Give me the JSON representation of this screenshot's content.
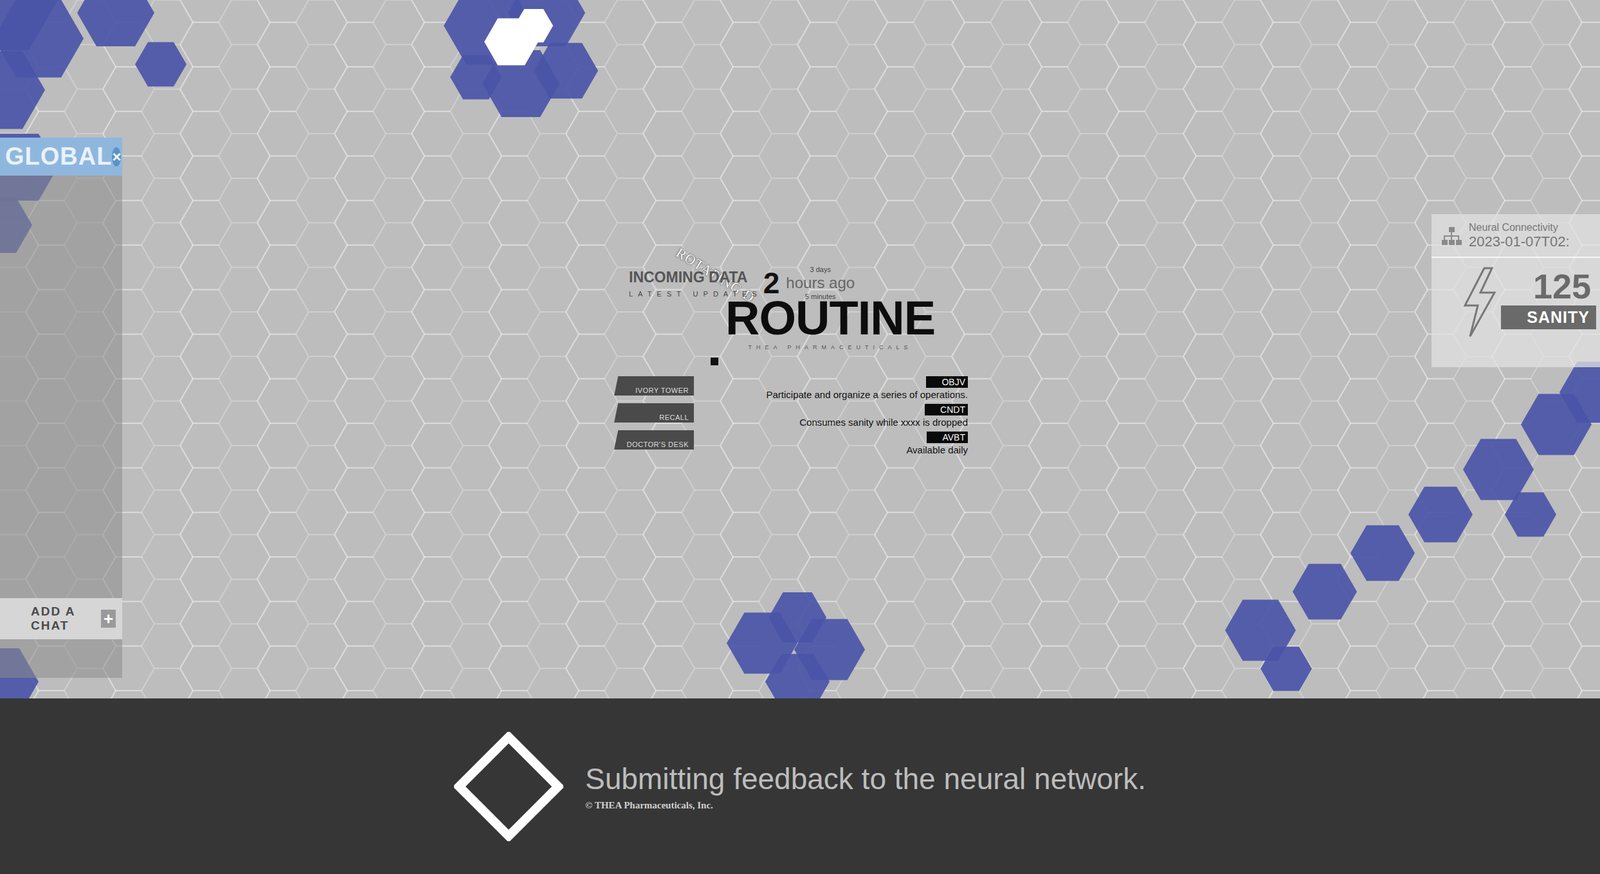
{
  "chat_panel": {
    "tab": "GLOBAL",
    "close": "×",
    "add_label": "ADD A CHAT",
    "add_icon": "+"
  },
  "rotating_label": "ROTATING D",
  "incoming": {
    "title": "INCOMING DATA",
    "subtitle": "LATEST UPDATES",
    "count": "2",
    "options": [
      {
        "label": "3 days",
        "selected": false
      },
      {
        "label": "hours ago",
        "selected": true
      },
      {
        "label": "5 minutes",
        "selected": false
      }
    ]
  },
  "routine": {
    "title": "ROUTINE",
    "brand": "THEA PHARMACEUTICALS",
    "menu": [
      "IVORY TOWER",
      "RECALL",
      "DOCTOR'S DESK"
    ],
    "details": [
      {
        "tag": "OBJV",
        "text": "Participate and organize a series of operations."
      },
      {
        "tag": "CNDT",
        "text": "Consumes sanity while xxxx is dropped"
      },
      {
        "tag": "AVBT",
        "text": "Available daily"
      }
    ]
  },
  "status": {
    "label": "Neural Connectivity",
    "timestamp": "2023-01-07T02:",
    "value": "125",
    "unit": "SANITY"
  },
  "loading": {
    "message": "Submitting feedback to the neural network.",
    "copyright": "© THEA Pharmaceuticals, Inc."
  }
}
